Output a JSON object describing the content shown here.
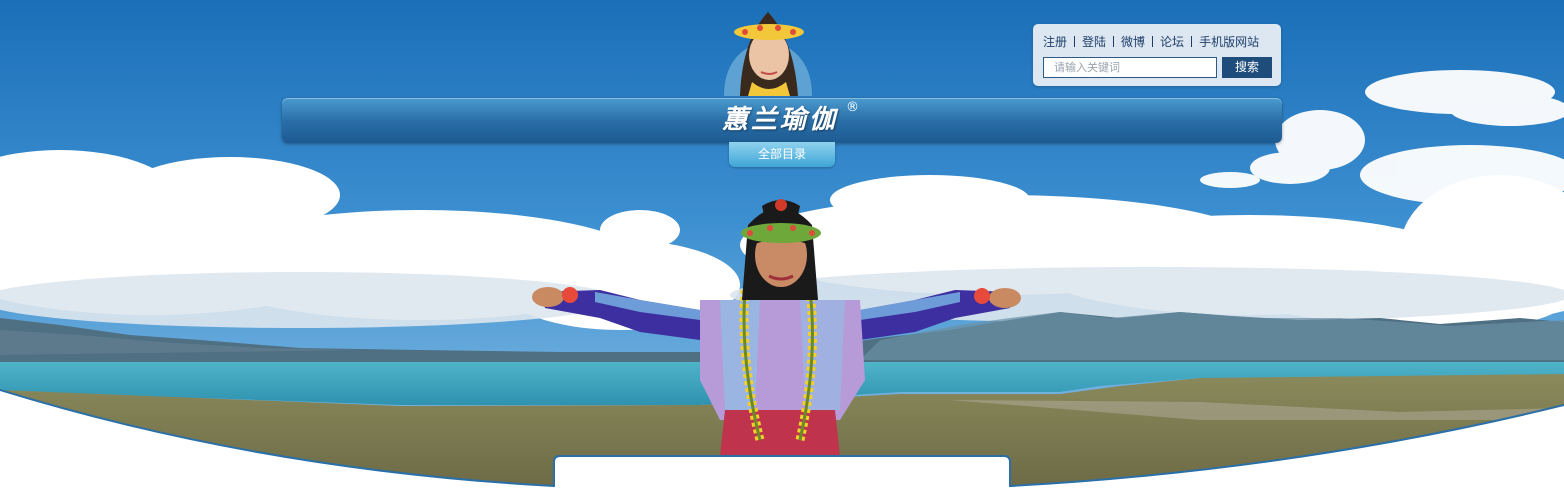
{
  "brand": {
    "logo_text": "蕙兰瑜伽",
    "registered_mark": "®"
  },
  "nav": {
    "catalog_label": "全部目录"
  },
  "top_links": [
    {
      "label": "注册"
    },
    {
      "label": "登陆"
    },
    {
      "label": "微博"
    },
    {
      "label": "论坛"
    },
    {
      "label": "手机版网站"
    }
  ],
  "search": {
    "placeholder": "请输入关键词",
    "button_label": "搜索"
  },
  "colors": {
    "banner_blue": "#2a6fa8",
    "panel_bg": "#e8eef4",
    "link_color": "#1f3f6a",
    "search_button": "#1e4d7b",
    "tab_cyan": "#3fa6d6",
    "frame_blue": "#2a6fa8"
  }
}
